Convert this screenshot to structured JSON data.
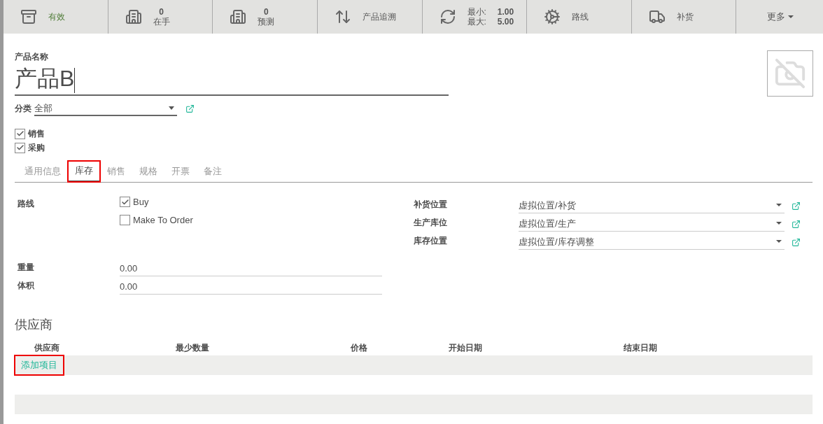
{
  "stat_buttons": [
    {
      "kind": "label",
      "label": "有效",
      "active": true
    },
    {
      "kind": "count",
      "value": "0",
      "label": "在手"
    },
    {
      "kind": "count",
      "value": "0",
      "label": "预测"
    },
    {
      "kind": "label",
      "label": "产品追溯",
      "active": false
    },
    {
      "kind": "minmax",
      "min_label": "最小:",
      "min": "1.00",
      "max_label": "最大:",
      "max": "5.00"
    },
    {
      "kind": "label",
      "label": "路线",
      "active": false
    },
    {
      "kind": "label",
      "label": "补货",
      "active": false
    },
    {
      "kind": "more",
      "label": "更多"
    }
  ],
  "product": {
    "name_label": "产品名称",
    "name": "产品B",
    "category_label": "分类",
    "category": "全部"
  },
  "flags": [
    {
      "label": "销售",
      "checked": true
    },
    {
      "label": "采购",
      "checked": true
    }
  ],
  "tabs": [
    {
      "label": "通用信息",
      "selected": false,
      "highlighted": false
    },
    {
      "label": "库存",
      "selected": true,
      "highlighted": true
    },
    {
      "label": "销售",
      "selected": false,
      "highlighted": false
    },
    {
      "label": "规格",
      "selected": false,
      "highlighted": false
    },
    {
      "label": "开票",
      "selected": false,
      "highlighted": false
    },
    {
      "label": "备注",
      "selected": false,
      "highlighted": false
    }
  ],
  "routes": {
    "label": "路线",
    "options": [
      {
        "label": "Buy",
        "checked": true
      },
      {
        "label": "Make To Order",
        "checked": false
      }
    ]
  },
  "locations": [
    {
      "label": "补货位置",
      "value": "虚拟位置/补货"
    },
    {
      "label": "生产库位",
      "value": "虚拟位置/生产"
    },
    {
      "label": "库存位置",
      "value": "虚拟位置/库存调整"
    }
  ],
  "measures": [
    {
      "label": "重量",
      "value": "0.00"
    },
    {
      "label": "体积",
      "value": "0.00"
    }
  ],
  "suppliers": {
    "title": "供应商",
    "columns": [
      "供应商",
      "最少数量",
      "价格",
      "开始日期",
      "结束日期"
    ],
    "add_item": {
      "label": "添加项目",
      "highlighted": true
    }
  }
}
